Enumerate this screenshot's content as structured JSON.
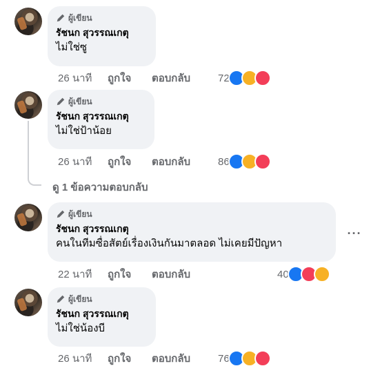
{
  "comments": [
    {
      "author_tag": "ผู้เขียน",
      "name": "รัชนก สุวรรณเกตุ",
      "text": "ไม่ใช่ซู",
      "time": "26 นาที",
      "like": "ถูกใจ",
      "reply": "ตอบกลับ",
      "reactions": "72"
    },
    {
      "author_tag": "ผู้เขียน",
      "name": "รัชนก สุวรรณเกตุ",
      "text": "ไม่ใช่ป้าน้อย",
      "time": "26 นาที",
      "like": "ถูกใจ",
      "reply": "ตอบกลับ",
      "reactions": "86"
    },
    {
      "author_tag": "ผู้เขียน",
      "name": "รัชนก สุวรรณเกตุ",
      "text": "คนในทีมซื่อสัตย์เรื่องเงินกันมาตลอด ไม่เคยมีปัญหา",
      "time": "22 นาที",
      "like": "ถูกใจ",
      "reply": "ตอบกลับ",
      "reactions": "40"
    },
    {
      "author_tag": "ผู้เขียน",
      "name": "รัชนก สุวรรณเกตุ",
      "text": "ไม่ใช่น้องบี",
      "time": "26 นาที",
      "like": "ถูกใจ",
      "reply": "ตอบกลับ",
      "reactions": "76"
    }
  ],
  "view_replies": "ดู 1 ข้อความตอบกลับ",
  "more_options": "···",
  "colors": {
    "like": "#1877f2",
    "love": "#f33e58",
    "care": "#f7b125",
    "bubble": "#f0f2f5"
  }
}
